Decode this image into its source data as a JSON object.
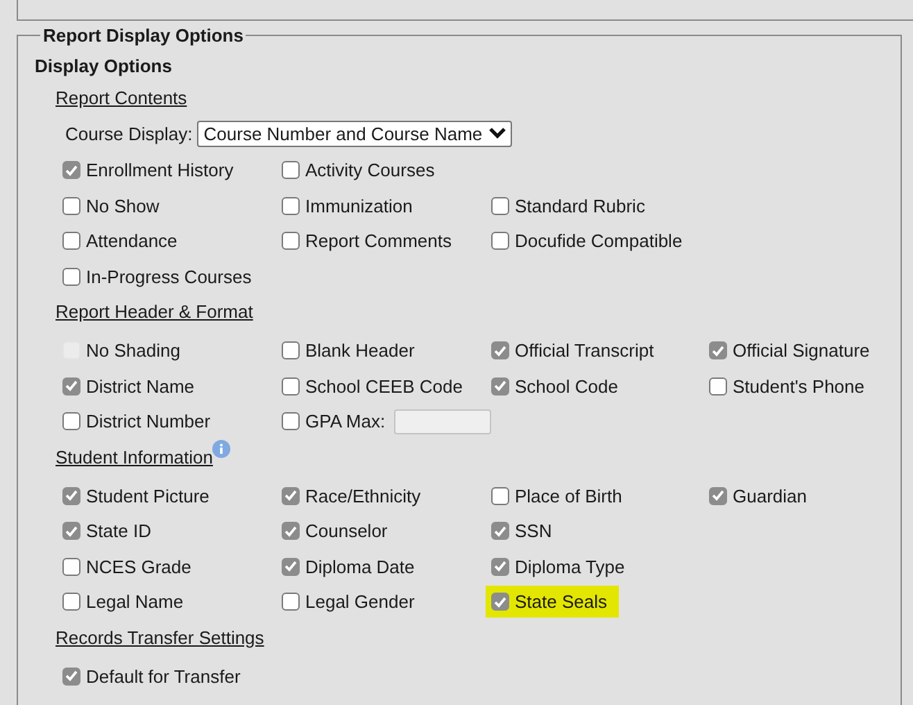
{
  "panel": {
    "legend": "Report Display Options",
    "heading": "Display Options",
    "sections": [
      {
        "title": "Report Contents",
        "info": false,
        "select": {
          "label": "Course Display:",
          "value": "Course Number and Course Name"
        },
        "rows": [
          [
            {
              "label": "Enrollment History",
              "checked": true,
              "disabled": false,
              "highlighted": false,
              "kind": "checkbox"
            },
            {
              "label": "Activity Courses",
              "checked": false,
              "disabled": false,
              "highlighted": false,
              "kind": "checkbox"
            }
          ],
          [
            {
              "label": "No Show",
              "checked": false,
              "disabled": false,
              "highlighted": false,
              "kind": "checkbox"
            },
            {
              "label": "Immunization",
              "checked": false,
              "disabled": false,
              "highlighted": false,
              "kind": "checkbox"
            },
            {
              "label": "Standard Rubric",
              "checked": false,
              "disabled": false,
              "highlighted": false,
              "kind": "checkbox"
            }
          ],
          [
            {
              "label": "Attendance",
              "checked": false,
              "disabled": false,
              "highlighted": false,
              "kind": "checkbox"
            },
            {
              "label": "Report Comments",
              "checked": false,
              "disabled": false,
              "highlighted": false,
              "kind": "checkbox"
            },
            {
              "label": "Docufide Compatible",
              "checked": false,
              "disabled": false,
              "highlighted": false,
              "kind": "checkbox"
            }
          ],
          [
            {
              "label": "In-Progress Courses",
              "checked": false,
              "disabled": false,
              "highlighted": false,
              "kind": "checkbox"
            }
          ]
        ]
      },
      {
        "title": "Report Header & Format",
        "info": false,
        "rows": [
          [
            {
              "label": "No Shading",
              "checked": false,
              "disabled": true,
              "highlighted": false,
              "kind": "checkbox"
            },
            {
              "label": "Blank Header",
              "checked": false,
              "disabled": false,
              "highlighted": false,
              "kind": "checkbox"
            },
            {
              "label": "Official Transcript",
              "checked": true,
              "disabled": false,
              "highlighted": false,
              "kind": "checkbox"
            },
            {
              "label": "Official Signature",
              "checked": true,
              "disabled": false,
              "highlighted": false,
              "kind": "checkbox"
            }
          ],
          [
            {
              "label": "District Name",
              "checked": true,
              "disabled": false,
              "highlighted": false,
              "kind": "checkbox"
            },
            {
              "label": "School CEEB Code",
              "checked": false,
              "disabled": false,
              "highlighted": false,
              "kind": "checkbox"
            },
            {
              "label": "School Code",
              "checked": true,
              "disabled": false,
              "highlighted": false,
              "kind": "checkbox"
            },
            {
              "label": "Student's Phone",
              "checked": false,
              "disabled": false,
              "highlighted": false,
              "kind": "checkbox"
            }
          ],
          [
            {
              "label": "District Number",
              "checked": false,
              "disabled": false,
              "highlighted": false,
              "kind": "checkbox"
            },
            {
              "label": "GPA Max:",
              "checked": false,
              "disabled": false,
              "highlighted": false,
              "kind": "checkbox-field"
            }
          ]
        ]
      },
      {
        "title": "Student Information",
        "info": true,
        "rows": [
          [
            {
              "label": "Student Picture",
              "checked": true,
              "disabled": false,
              "highlighted": false,
              "kind": "checkbox"
            },
            {
              "label": "Race/Ethnicity",
              "checked": true,
              "disabled": false,
              "highlighted": false,
              "kind": "checkbox"
            },
            {
              "label": "Place of Birth",
              "checked": false,
              "disabled": false,
              "highlighted": false,
              "kind": "checkbox"
            },
            {
              "label": "Guardian",
              "checked": true,
              "disabled": false,
              "highlighted": false,
              "kind": "checkbox"
            }
          ],
          [
            {
              "label": "State ID",
              "checked": true,
              "disabled": false,
              "highlighted": false,
              "kind": "checkbox"
            },
            {
              "label": "Counselor",
              "checked": true,
              "disabled": false,
              "highlighted": false,
              "kind": "checkbox"
            },
            {
              "label": "SSN",
              "checked": true,
              "disabled": false,
              "highlighted": false,
              "kind": "checkbox"
            }
          ],
          [
            {
              "label": "NCES Grade",
              "checked": false,
              "disabled": false,
              "highlighted": false,
              "kind": "checkbox"
            },
            {
              "label": "Diploma Date",
              "checked": true,
              "disabled": false,
              "highlighted": false,
              "kind": "checkbox"
            },
            {
              "label": "Diploma Type",
              "checked": true,
              "disabled": false,
              "highlighted": false,
              "kind": "checkbox"
            }
          ],
          [
            {
              "label": "Legal Name",
              "checked": false,
              "disabled": false,
              "highlighted": false,
              "kind": "checkbox"
            },
            {
              "label": "Legal Gender",
              "checked": false,
              "disabled": false,
              "highlighted": false,
              "kind": "checkbox"
            },
            {
              "label": "State Seals",
              "checked": true,
              "disabled": false,
              "highlighted": true,
              "kind": "checkbox"
            }
          ]
        ]
      },
      {
        "title": "Records Transfer Settings",
        "info": false,
        "rows": [
          [
            {
              "label": "Default for Transfer",
              "checked": true,
              "disabled": false,
              "highlighted": false,
              "kind": "checkbox"
            }
          ]
        ]
      }
    ]
  }
}
